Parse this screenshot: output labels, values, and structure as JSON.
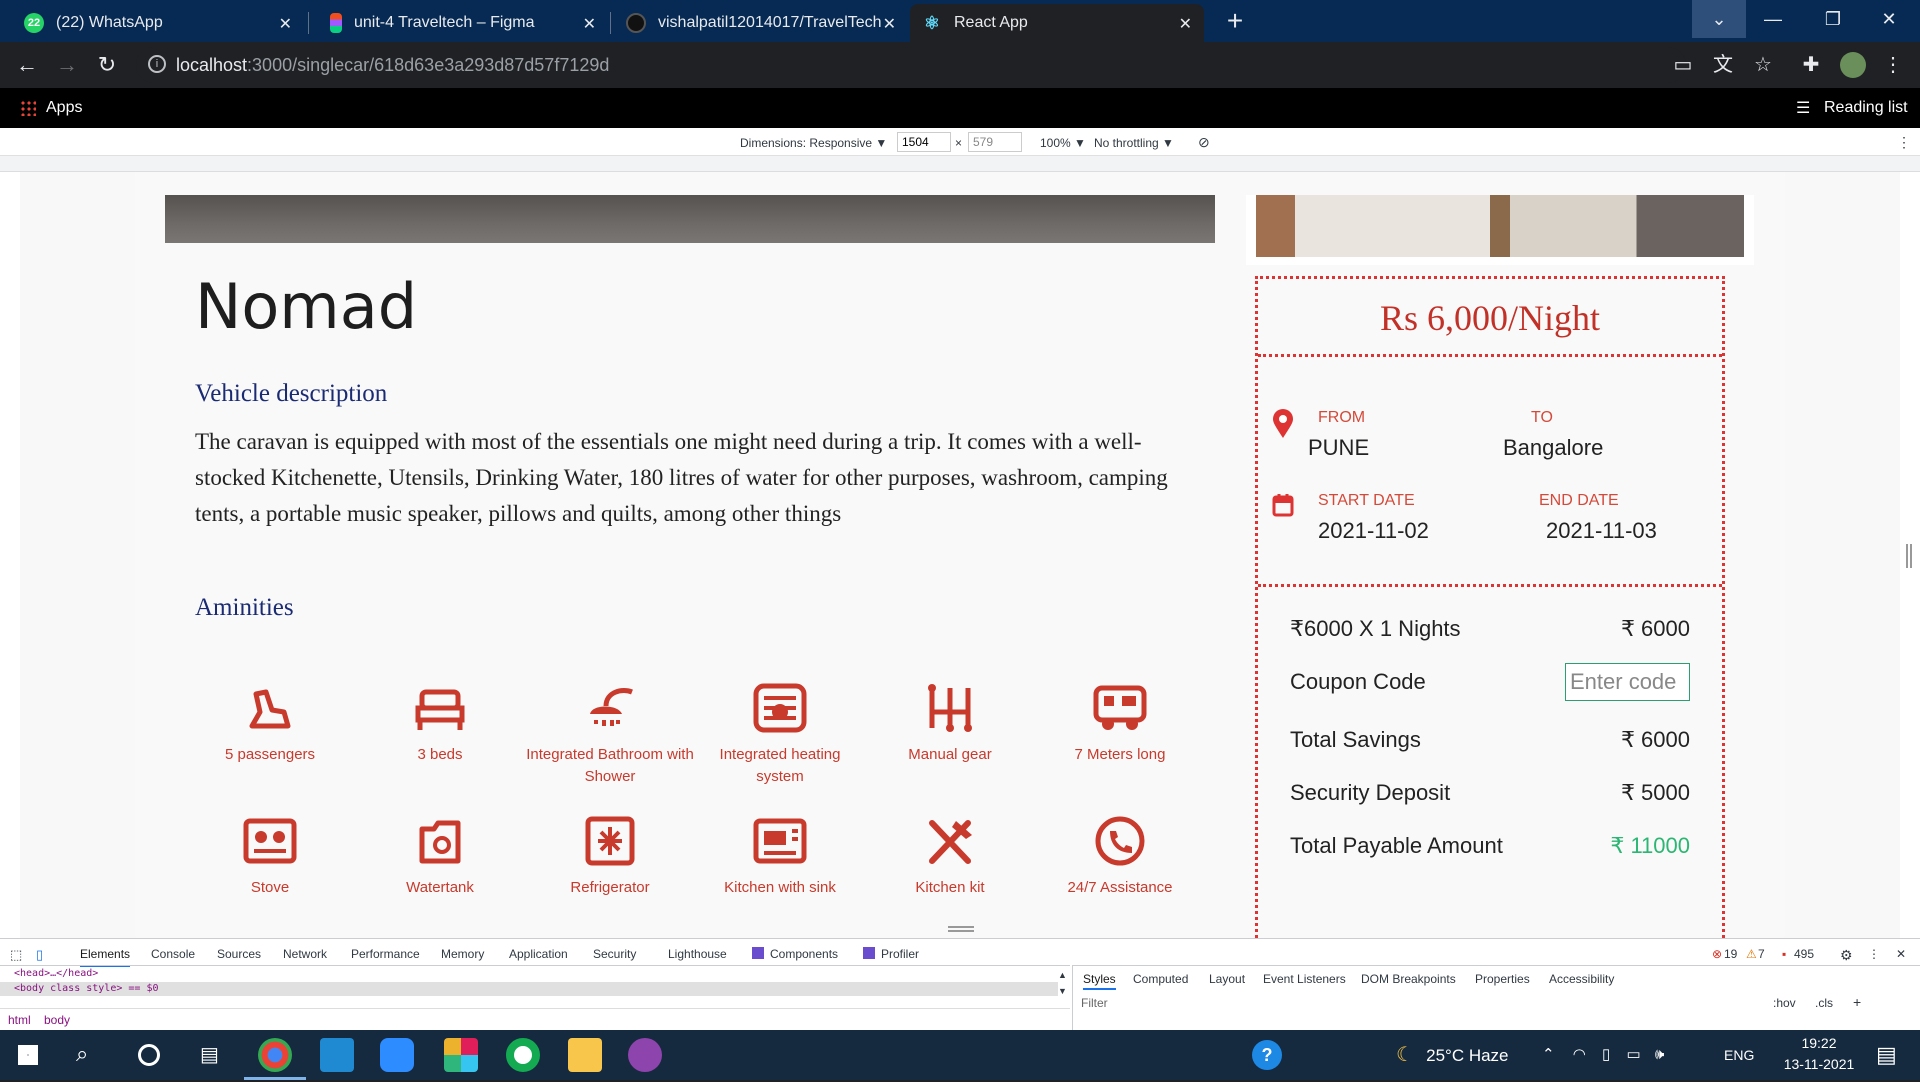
{
  "browser": {
    "tabs": [
      {
        "title": "(22) WhatsApp",
        "favicon": "whatsapp-icon",
        "badge": "22"
      },
      {
        "title": "unit-4 Traveltech – Figma",
        "favicon": "figma-icon"
      },
      {
        "title": "vishalpatil12014017/TravelTech",
        "favicon": "github-icon"
      },
      {
        "title": "React App",
        "favicon": "react-icon",
        "active": true
      }
    ],
    "url_host": "localhost",
    "url_path": ":3000/singlecar/618d63e3a293d87d57f7129d",
    "bookmarks": {
      "apps_label": "Apps",
      "reading_list": "Reading list"
    }
  },
  "device_toolbar": {
    "dimensions_label": "Dimensions: Responsive ▼",
    "width": "1504",
    "height": "579",
    "times": "×",
    "zoom": "100% ▼",
    "throttling": "No throttling ▼"
  },
  "page": {
    "vehicle_name": "Nomad",
    "description_heading": "Vehicle description",
    "description_text": "The caravan is equipped with most of the essentials one might need during a trip. It comes with a well-stocked Kitchenette, Utensils, Drinking Water, 180 litres of water for other purposes, washroom, camping tents, a portable music speaker, pillows and quilts, among other things",
    "amenities_heading": "Aminities",
    "amenities": [
      {
        "label": "5 passengers",
        "icon": "seat-icon"
      },
      {
        "label": "3 beds",
        "icon": "bed-icon"
      },
      {
        "label": "Integrated Bathroom with Shower",
        "icon": "shower-icon"
      },
      {
        "label": "Integrated heating system",
        "icon": "heater-icon"
      },
      {
        "label": "Manual gear",
        "icon": "gear-shift-icon"
      },
      {
        "label": "7 Meters long",
        "icon": "caravan-icon"
      },
      {
        "label": "Stove",
        "icon": "stove-icon"
      },
      {
        "label": "Watertank",
        "icon": "water-tank-icon"
      },
      {
        "label": "Refrigerator",
        "icon": "refrigerator-icon"
      },
      {
        "label": "Kitchen with sink",
        "icon": "sink-icon"
      },
      {
        "label": "Kitchen kit",
        "icon": "utensils-icon"
      },
      {
        "label": "24/7 Assistance",
        "icon": "phone-icon"
      }
    ],
    "booking": {
      "price": "Rs 6,000/Night",
      "from_label": "FROM",
      "from_value": "PUNE",
      "to_label": "TO",
      "to_value": "Bangalore",
      "start_label": "START DATE",
      "start_value": "2021-11-02",
      "end_label": "END DATE",
      "end_value": "2021-11-03",
      "nights_label": "₹6000 X 1 Nights",
      "nights_value": "₹ 6000",
      "coupon_label": "Coupon Code",
      "coupon_placeholder": "Enter code",
      "savings_label": "Total Savings",
      "savings_value": "₹ 6000",
      "deposit_label": "Security Deposit",
      "deposit_value": "₹ 5000",
      "total_label": "Total Payable Amount",
      "total_value": "₹ 11000"
    }
  },
  "devtools": {
    "tabs": [
      "Elements",
      "Console",
      "Sources",
      "Network",
      "Performance",
      "Memory",
      "Application",
      "Security",
      "Lighthouse",
      "Components",
      "Profiler"
    ],
    "errors": "19",
    "warnings": "7",
    "issues": "495",
    "head_line": "<head>…</head>",
    "body_line": "<body class style> == $0",
    "crumbs": [
      "html",
      "body"
    ],
    "side_tabs": [
      "Styles",
      "Computed",
      "Layout",
      "Event Listeners",
      "DOM Breakpoints",
      "Properties",
      "Accessibility"
    ],
    "filter_placeholder": "Filter",
    "hov": ":hov",
    "cls": ".cls"
  },
  "taskbar": {
    "weather": "25°C  Haze",
    "lang": "ENG",
    "time": "19:22",
    "date": "13-11-2021"
  },
  "colors": {
    "accent_red": "#c83a2c",
    "heading_blue": "#1a2a73",
    "total_green": "#2bb673",
    "tabbar_blue": "#062a53"
  }
}
